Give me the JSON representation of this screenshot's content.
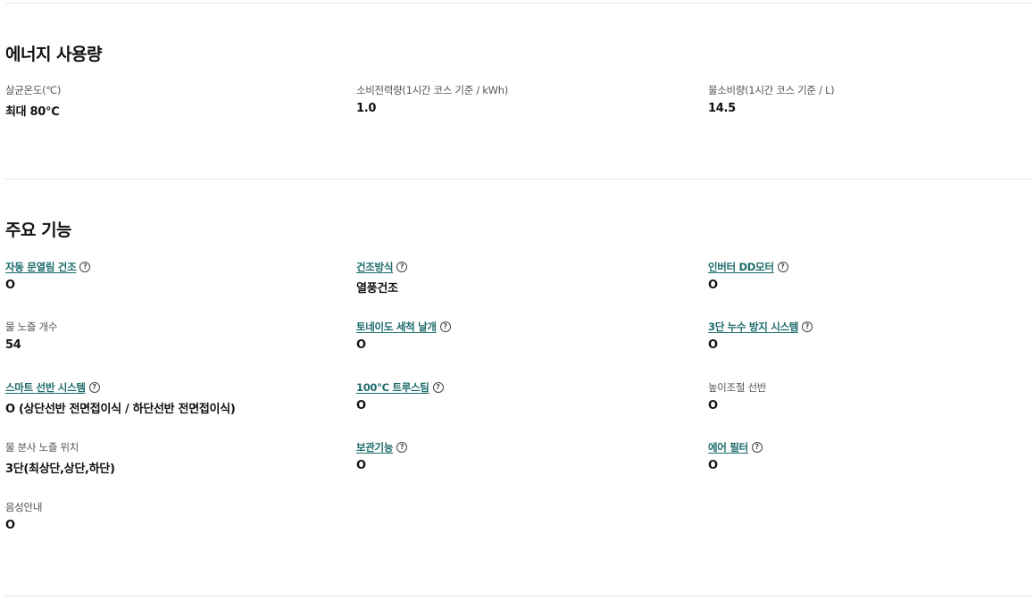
{
  "energy": {
    "title": "에너지 사용량",
    "specs": [
      {
        "label": "살균온도(℃)",
        "value": "최대 80℃"
      },
      {
        "label": "소비전력량(1시간 코스 기준 / kWh)",
        "value": "1.0"
      },
      {
        "label": "물소비량(1시간 코스 기준 / L)",
        "value": "14.5"
      }
    ]
  },
  "features": {
    "title": "주요 기능",
    "help_glyph": "?",
    "specs": [
      {
        "label": "자동 문열림 건조",
        "value": "O"
      },
      {
        "label": "건조방식",
        "value": "열풍건조"
      },
      {
        "label": "인버터 DD모터",
        "value": "O"
      },
      {
        "label": "물 노즐 개수",
        "value": "54"
      },
      {
        "label": "토네이도 세척 날개",
        "value": "O"
      },
      {
        "label": "3단 누수 방지 시스템",
        "value": "O"
      },
      {
        "label": "스마트 선반 시스템",
        "value": "O (상단선반 전면접이식 / 하단선반 전면접이식)"
      },
      {
        "label": "100℃ 트루스팀",
        "value": "O"
      },
      {
        "label": "높이조절 선반",
        "value": "O"
      },
      {
        "label": "물 분사 노즐 위치",
        "value": "3단(최상단,상단,하단)"
      },
      {
        "label": "보관기능",
        "value": "O"
      },
      {
        "label": "에어 필터",
        "value": "O"
      },
      {
        "label": "음성안내",
        "value": "O"
      }
    ]
  }
}
